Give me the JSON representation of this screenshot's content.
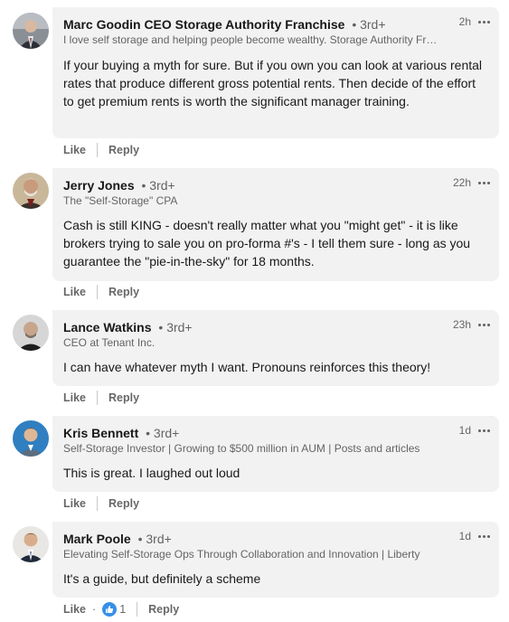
{
  "comments": [
    {
      "name": "Marc Goodin CEO Storage Authority Franchise",
      "degree": "• 3rd+",
      "headline": "I love self storage and helping people become wealthy. Storage Authority Franchise",
      "time": "2h",
      "text": "If your buying a myth for sure. But if you own you can look at various rental rates that produce different gross potential rents. Then decide of the effort to get premium rents is worth the significant manager training.",
      "like_label": "Like",
      "reply_label": "Reply"
    },
    {
      "name": "Jerry Jones",
      "degree": "• 3rd+",
      "headline": "The \"Self-Storage\" CPA",
      "time": "22h",
      "text": "Cash is still KING - doesn't really matter what you \"might get\" - it is like brokers trying to sale you on pro-forma #'s - I tell them sure - long as you guarantee the \"pie-in-the-sky\" for 18 months.",
      "like_label": "Like",
      "reply_label": "Reply"
    },
    {
      "name": "Lance Watkins",
      "degree": "• 3rd+",
      "headline": "CEO at Tenant Inc.",
      "time": "23h",
      "text": "I can have whatever myth I want. Pronouns reinforces this theory!",
      "like_label": "Like",
      "reply_label": "Reply"
    },
    {
      "name": "Kris Bennett",
      "degree": "• 3rd+",
      "headline": "Self-Storage Investor | Growing to $500 million in AUM | Posts and articles",
      "time": "1d",
      "text": "This is great. I laughed out loud",
      "like_label": "Like",
      "reply_label": "Reply"
    },
    {
      "name": "Mark Poole",
      "degree": "• 3rd+",
      "headline": "Elevating Self-Storage Ops Through Collaboration and Innovation | Liberty",
      "time": "1d",
      "text": "It's a guide, but definitely a scheme",
      "like_label": "Like",
      "reply_label": "Reply",
      "reaction_dot": "·",
      "reaction_icon": "thumbs-up-icon",
      "reaction_count": "1"
    }
  ],
  "colors": {
    "bubble_bg": "#f2f2f2",
    "reaction_blue": "#378fe9",
    "secondary_text": "#666666"
  }
}
